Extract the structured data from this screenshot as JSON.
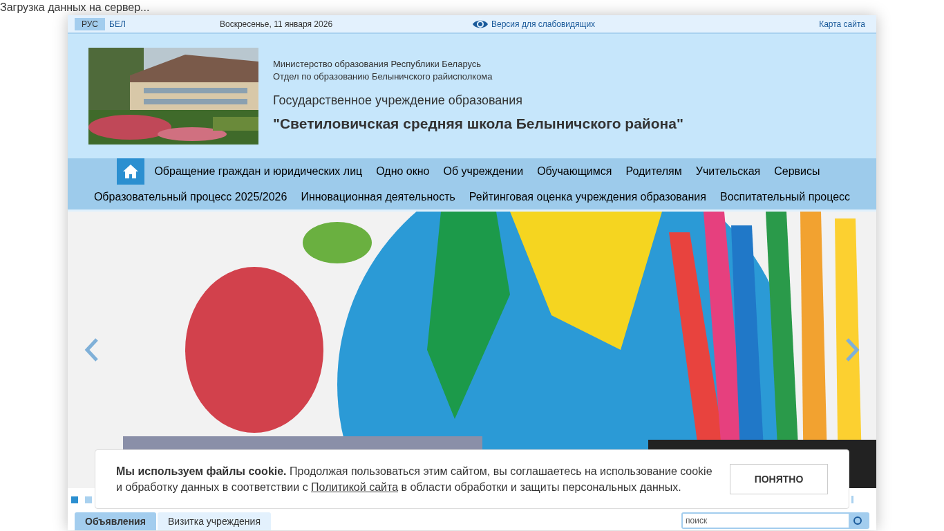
{
  "loading_text": "Загрузка данных на сервер...",
  "top_bar": {
    "languages": [
      {
        "label": "РУС",
        "selected": true
      },
      {
        "label": "БЕЛ",
        "selected": false
      }
    ],
    "date": "Воскресенье, 11 января 2026",
    "accessibility_link": "Версия для слабовидящих",
    "sitemap_link": "Карта сайта"
  },
  "header": {
    "ministry": "Министерство образования Республики Беларусь",
    "department": "Отдел по образованию Белыничского райисполкома",
    "institution_type": "Государственное учреждение образования",
    "institution_name": "\"Светиловичская средняя школа Белыничского района\""
  },
  "nav": {
    "rows": [
      {
        "links": [
          "Обращение граждан и юридических лиц",
          "Одно окно",
          "Об учреждении",
          "Обучающимся",
          "Родителям",
          "Учительская",
          "Сервисы"
        ]
      },
      {
        "links": [
          "Образовательный процесс 2025/2026",
          "Инновационная деятельность",
          "Рейтинговая оценка учреждения образования",
          "Воспитательный процесс"
        ]
      }
    ]
  },
  "slider": {
    "dots": [
      {
        "selected": true
      },
      {
        "selected": false
      }
    ]
  },
  "cookie": {
    "text": "**Мы используем файлы cookie.** Продолжая пользоваться этим сайтом, вы соглашаетесь на использование cookie и обработку данных в соответствии с",
    "link": "Политикой сайта",
    "text_after": "в области обработки и защиты персональных данных.",
    "button": "ПОНЯТНО"
  },
  "tabs": [
    {
      "label": "Объявления",
      "selected": true
    },
    {
      "label": "Визитка учреждения",
      "selected": false
    }
  ],
  "search": {
    "placeholder": "поиск"
  }
}
